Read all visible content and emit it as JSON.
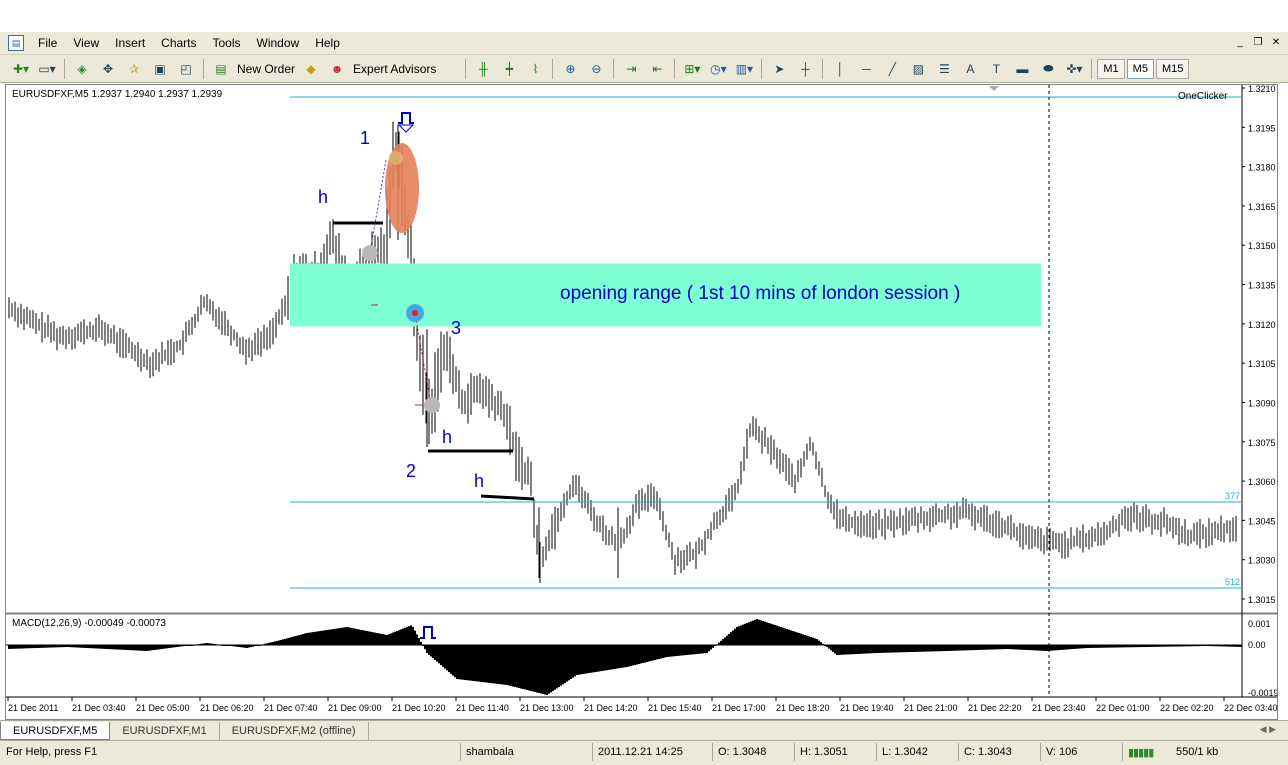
{
  "menu": {
    "items": [
      "File",
      "View",
      "Insert",
      "Charts",
      "Tools",
      "Window",
      "Help"
    ]
  },
  "toolbar": {
    "new_order": "New Order",
    "expert_advisors": "Expert Advisors",
    "timeframes": [
      "M1",
      "M5",
      "M15"
    ],
    "active_timeframe": "M5"
  },
  "chart": {
    "header": "EURUSDFXF,M5  1.2937 1.2940 1.2937 1.2939",
    "oneclicker_label": "OneClicker",
    "line_labels": [
      "377",
      "512"
    ],
    "annotations": {
      "label_1": "1",
      "label_2": "2",
      "label_3": "3",
      "h_labels": [
        "h",
        "h",
        "h"
      ],
      "opening_range": "opening range ( 1st 10 mins of london session )"
    },
    "price_axis": [
      "1.3210",
      "1.3195",
      "1.3180",
      "1.3165",
      "1.3150",
      "1.3135",
      "1.3120",
      "1.3105",
      "1.3090",
      "1.3075",
      "1.3060",
      "1.3045",
      "1.3030",
      "1.3015"
    ],
    "macd_header": "MACD(12,26,9) -0.00049 -0.00073",
    "macd_axis": [
      "0.001",
      "0.00",
      "-0.0019"
    ],
    "time_axis": [
      "21 Dec 2011",
      "21 Dec 03:40",
      "21 Dec 05:00",
      "21 Dec 06:20",
      "21 Dec 07:40",
      "21 Dec 09:00",
      "21 Dec 10:20",
      "21 Dec 11:40",
      "21 Dec 13:00",
      "21 Dec 14:20",
      "21 Dec 15:40",
      "21 Dec 17:00",
      "21 Dec 18:20",
      "21 Dec 19:40",
      "21 Dec 21:00",
      "21 Dec 22:20",
      "21 Dec 23:40",
      "22 Dec 01:00",
      "22 Dec 02:20",
      "22 Dec 03:40"
    ],
    "colors": {
      "opening_range": "#7fffd4",
      "annotation_text": "#0000cc",
      "level_line": "#1fb0d8",
      "big_marker": "#e6805a"
    }
  },
  "tabs": [
    "EURUSDFXF,M5",
    "EURUSDFXF,M1",
    "EURUSDFXF,M2 (offline)"
  ],
  "active_tab": "EURUSDFXF,M5",
  "status": {
    "help": "For Help, press F1",
    "profile": "shambala",
    "datetime": "2011.12.21 14:25",
    "open": "O: 1.3048",
    "high": "H: 1.3051",
    "low": "L: 1.3042",
    "close": "C: 1.3043",
    "volume": "V: 106",
    "traffic": "550/1 kb"
  },
  "chart_data": {
    "type": "bar",
    "title": "EURUSDFXF,M5",
    "ylim": [
      1.3008,
      1.3212
    ],
    "key_prices": {
      "open_before_london": 1.3125,
      "spike_high": 1.3196,
      "range_top": 1.3143,
      "range_bottom": 1.3119,
      "drop_low": 1.3073,
      "session_low": 1.3023,
      "afternoon_high": 1.3083,
      "close": 1.3043
    }
  }
}
